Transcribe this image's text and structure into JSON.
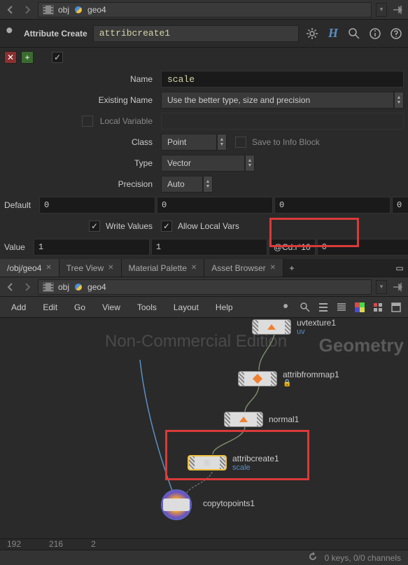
{
  "top_nav": {
    "crumb1": "obj",
    "crumb2": "geo4"
  },
  "attr_create": {
    "title": "Attribute Create",
    "node_name": "attribcreate1",
    "fields": {
      "name_label": "Name",
      "name_value": "scale",
      "existing_label": "Existing Name",
      "existing_value": "Use the better type, size and precision",
      "localvar_label": "Local Variable",
      "class_label": "Class",
      "class_value": "Point",
      "save_info_label": "Save to Info Block",
      "type_label": "Type",
      "type_value": "Vector",
      "precision_label": "Precision",
      "precision_value": "Auto",
      "default_label": "Default",
      "default_values": [
        "0",
        "0",
        "0",
        "0"
      ],
      "write_label": "Write Values",
      "allow_label": "Allow Local Vars",
      "value_label": "Value",
      "value_values": [
        "1",
        "1",
        "@Cd.r*10",
        "0"
      ]
    }
  },
  "tabs": [
    {
      "label": "/obj/geo4",
      "active": true
    },
    {
      "label": "Tree View",
      "active": false
    },
    {
      "label": "Material Palette",
      "active": false
    },
    {
      "label": "Asset Browser",
      "active": false
    }
  ],
  "net_nav": {
    "crumb1": "obj",
    "crumb2": "geo4"
  },
  "menu": [
    "Add",
    "Edit",
    "Go",
    "View",
    "Tools",
    "Layout",
    "Help"
  ],
  "watermark1": "Non-Commercial Edition",
  "watermark2": "Geometry",
  "nodes": {
    "uvtexture": {
      "label": "uvtexture1",
      "sub": "uv"
    },
    "attribfrommap": {
      "label": "attribfrommap1"
    },
    "normal": {
      "label": "normal1"
    },
    "attribcreate": {
      "label": "attribcreate1",
      "sub": "scale"
    },
    "copytopoints": {
      "label": "copytopoints1"
    }
  },
  "ruler": [
    "192",
    "216",
    "2"
  ],
  "footer": "0 keys, 0/0 channels"
}
